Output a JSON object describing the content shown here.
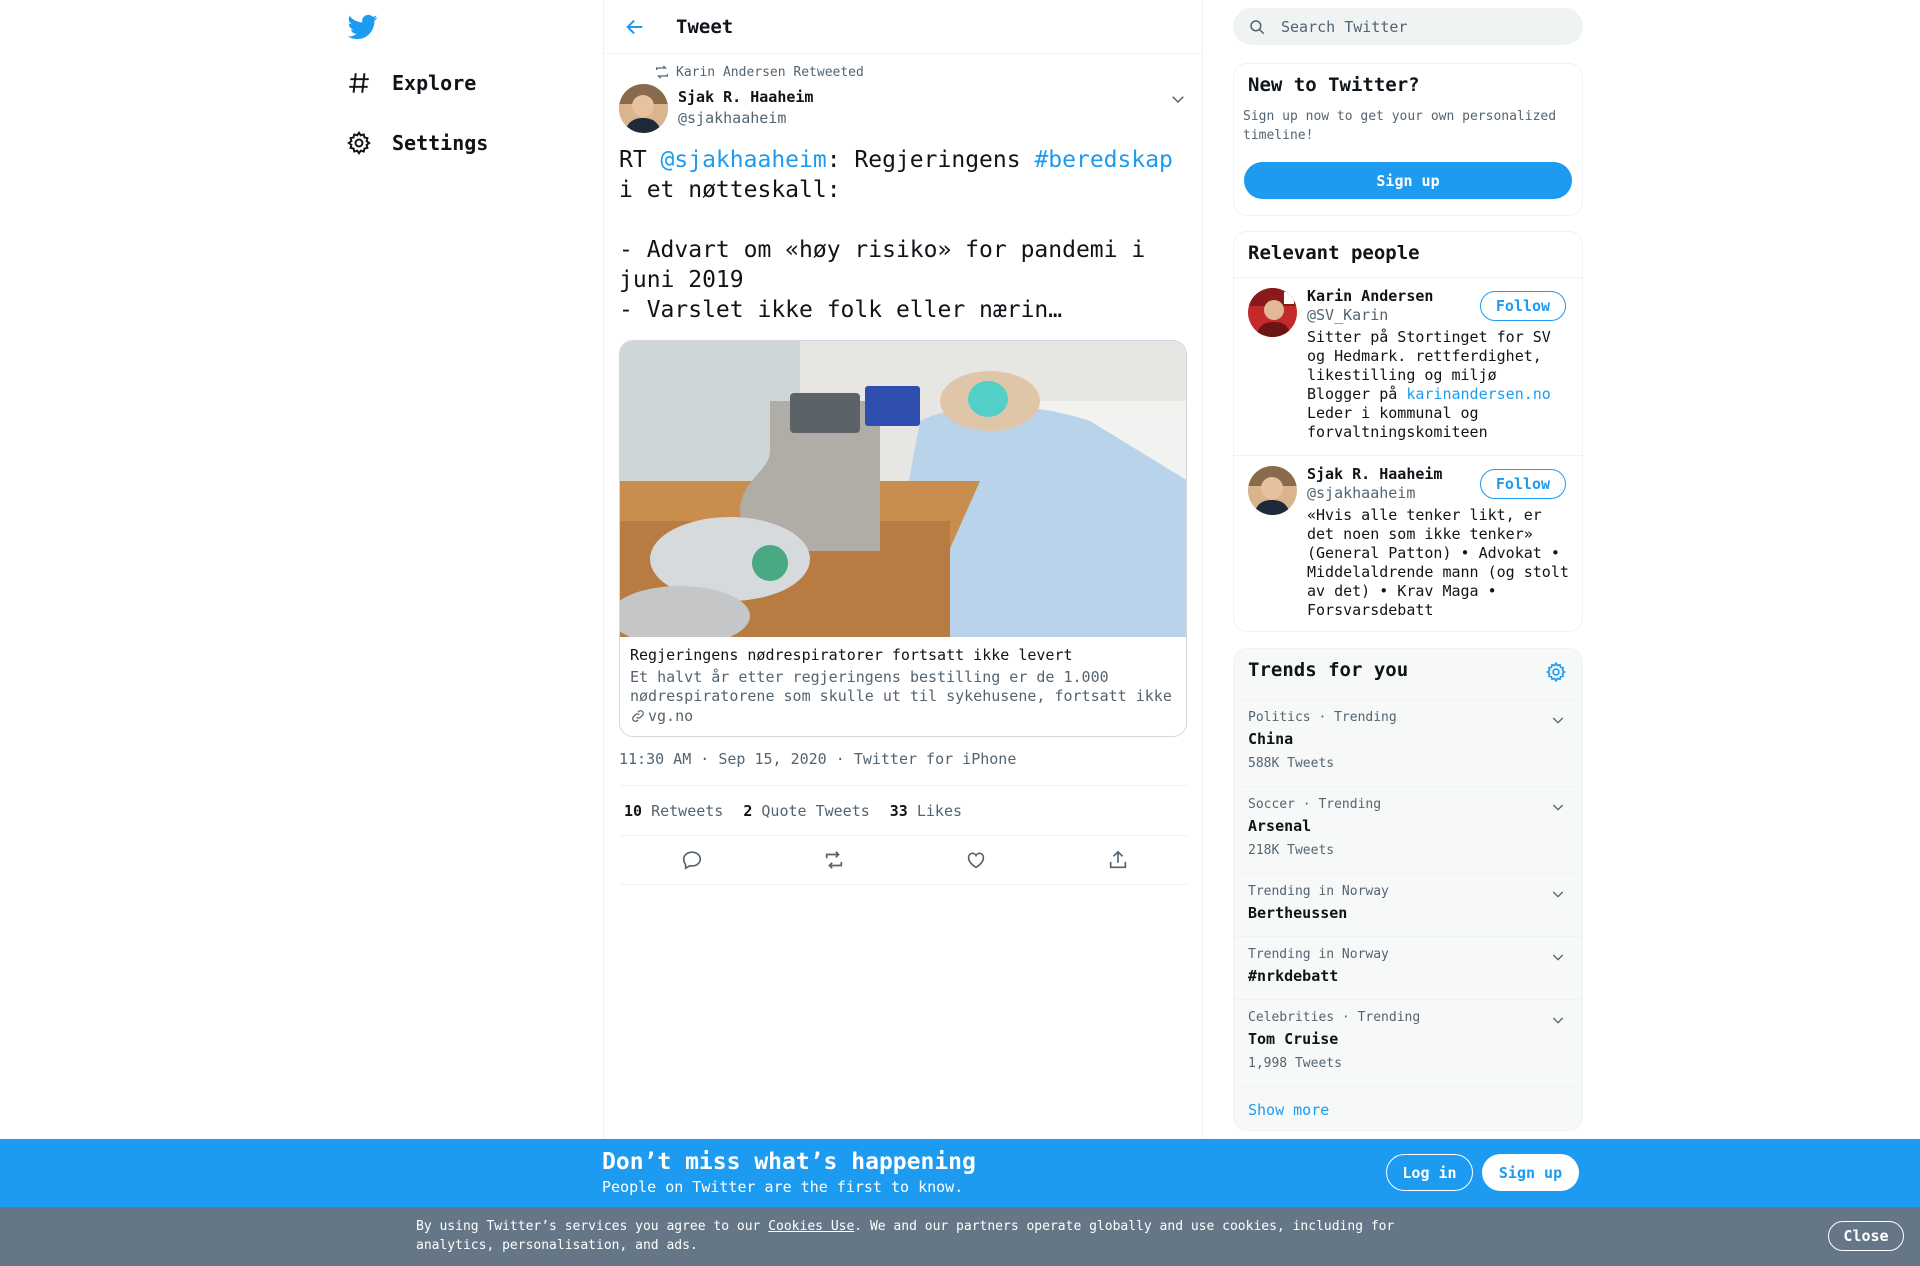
{
  "nav": {
    "logo_icon": "twitter-bird-icon",
    "items": [
      {
        "label": "Explore",
        "icon": "hash-icon"
      },
      {
        "label": "Settings",
        "icon": "gear-icon"
      }
    ]
  },
  "header": {
    "title": "Tweet"
  },
  "tweet": {
    "retweeted_by": "Karin Andersen Retweeted",
    "author_name": "Sjak R. Haaheim",
    "author_handle": "@sjakhaaheim",
    "text_prefix": "RT ",
    "mention": "@sjakhaaheim",
    "text_mid": ": Regjeringens ",
    "hashtag": "#beredskap",
    "text_rest": "\ni et nøtteskall:\n\n- Advart om «høy risiko» for pandemi i\njuni 2019\n- Varslet ikke folk eller nærin…",
    "card_title": "Regjeringens nødrespiratorer fortsatt ikke levert",
    "card_desc": "Et halvt år etter regjeringens bestilling er de 1.000 nødrespiratorene som skulle ut til sykehusene, fortsatt ikke levert.",
    "card_domain": "vg.no",
    "time": "11:30 AM · Sep 15, 2020",
    "source": "Twitter for iPhone",
    "retweets": "10",
    "retweets_label": "Retweets",
    "quotes": "2",
    "quotes_label": "Quote Tweets",
    "likes": "33",
    "likes_label": "Likes"
  },
  "search": {
    "placeholder": "Search Twitter"
  },
  "new_to_twitter": {
    "title": "New to Twitter?",
    "text": "Sign up now to get your own personalized timeline!",
    "button": "Sign up"
  },
  "relevant": {
    "title": "Relevant people",
    "people": [
      {
        "name": "Karin Andersen",
        "handle": "@SV_Karin",
        "bio_pre": "Sitter på Stortinget for SV og Hedmark. rettferdighet, likestilling og miljø\nBlogger på ",
        "bio_link": "karinandersen.no",
        "bio_post": "\nLeder i kommunal og forvaltningskomiteen",
        "follow": "Follow"
      },
      {
        "name": "Sjak R. Haaheim",
        "handle": "@sjakhaaheim",
        "bio_pre": "«Hvis alle tenker likt, er det noen som ikke tenker» (General Patton) • Advokat • Middelaldrende mann (og stolt av det) • Krav Maga • Forsvarsdebatt",
        "bio_link": "",
        "bio_post": "",
        "follow": "Follow"
      }
    ]
  },
  "trends": {
    "title": "Trends for you",
    "items": [
      {
        "context": "Politics · Trending",
        "name": "China",
        "count": "588K Tweets"
      },
      {
        "context": "Soccer · Trending",
        "name": "Arsenal",
        "count": "218K Tweets"
      },
      {
        "context": "Trending in Norway",
        "name": "Bertheussen",
        "count": ""
      },
      {
        "context": "Trending in Norway",
        "name": "#nrkdebatt",
        "count": ""
      },
      {
        "context": "Celebrities · Trending",
        "name": "Tom Cruise",
        "count": "1,998 Tweets"
      }
    ],
    "show_more": "Show more"
  },
  "banner": {
    "title": "Don’t miss what’s happening",
    "subtitle": "People on Twitter are the first to know.",
    "login": "Log in",
    "signup": "Sign up"
  },
  "cookie": {
    "text_pre": "By using Twitter’s services you agree to our ",
    "link": "Cookies Use",
    "text_post": ". We and our partners operate globally and use cookies, including for analytics, personalisation, and ads.",
    "close": "Close"
  },
  "colors": {
    "accent": "#1d9bf0",
    "text": "#0f1419",
    "muted": "#536471",
    "cookie_bg": "#657786"
  }
}
